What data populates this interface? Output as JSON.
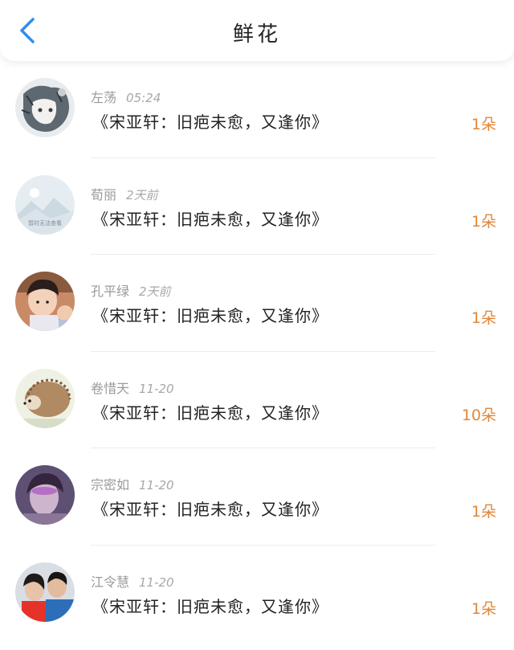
{
  "header": {
    "title": "鲜花",
    "back_icon": "chevron-left-icon",
    "accent_color": "#2f8fe8"
  },
  "avatar_placeholder_text": "暂时无法查看",
  "items": [
    {
      "name": "左荡",
      "time": "05:24",
      "text": "《宋亚轩：旧疤未愈，又逢你》",
      "count": "1朵"
    },
    {
      "name": "荀丽",
      "time": "2天前",
      "text": "《宋亚轩：旧疤未愈，又逢你》",
      "count": "1朵"
    },
    {
      "name": "孔平绿",
      "time": "2天前",
      "text": "《宋亚轩：旧疤未愈，又逢你》",
      "count": "1朵"
    },
    {
      "name": "卷惜天",
      "time": "11-20",
      "text": "《宋亚轩：旧疤未愈，又逢你》",
      "count": "10朵"
    },
    {
      "name": "宗密如",
      "time": "11-20",
      "text": "《宋亚轩：旧疤未愈，又逢你》",
      "count": "1朵"
    },
    {
      "name": "江令慧",
      "time": "11-20",
      "text": "《宋亚轩：旧疤未愈，又逢你》",
      "count": "1朵"
    }
  ],
  "colors": {
    "count": "#e0873a",
    "meta": "#9a9a9a"
  }
}
